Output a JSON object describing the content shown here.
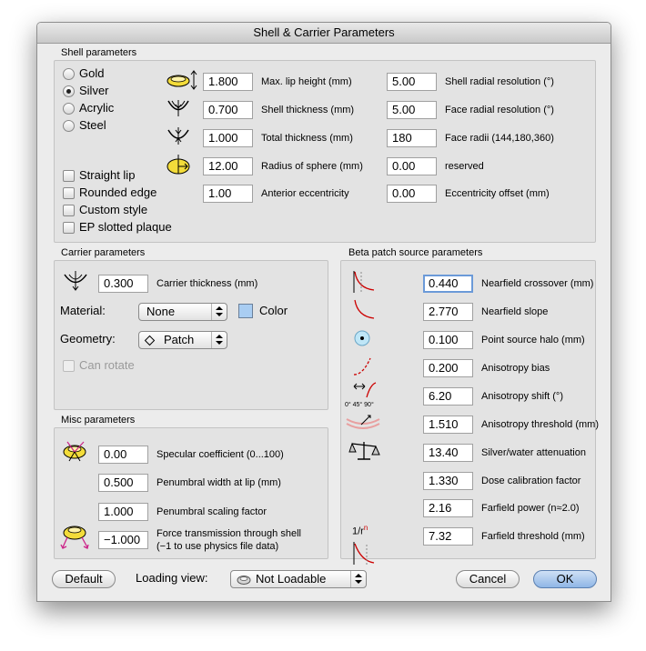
{
  "window": {
    "title": "Shell & Carrier Parameters"
  },
  "shell": {
    "title": "Shell parameters",
    "materials": [
      {
        "label": "Gold",
        "selected": false
      },
      {
        "label": "Silver",
        "selected": true
      },
      {
        "label": "Acrylic",
        "selected": false
      },
      {
        "label": "Steel",
        "selected": false
      }
    ],
    "options": [
      {
        "label": "Straight lip",
        "checked": false
      },
      {
        "label": "Rounded edge",
        "checked": false
      },
      {
        "label": "Custom style",
        "checked": false
      },
      {
        "label": "EP slotted plaque",
        "checked": false
      }
    ],
    "left_fields": [
      {
        "value": "1.800",
        "label": "Max. lip height (mm)",
        "icon": "lip-height-icon"
      },
      {
        "value": "0.700",
        "label": "Shell thickness (mm)",
        "icon": "shell-thickness-icon"
      },
      {
        "value": "1.000",
        "label": "Total thickness (mm)",
        "icon": "total-thickness-icon"
      },
      {
        "value": "12.00",
        "label": "Radius of sphere (mm)",
        "icon": "sphere-radius-icon"
      },
      {
        "value": "1.00",
        "label": "Anterior eccentricity",
        "icon": ""
      }
    ],
    "right_fields": [
      {
        "value": "5.00",
        "label": "Shell radial resolution (°)"
      },
      {
        "value": "5.00",
        "label": "Face radial resolution (°)"
      },
      {
        "value": "180",
        "label": "Face radii (144,180,360)"
      },
      {
        "value": "0.00",
        "label": "reserved"
      },
      {
        "value": "0.00",
        "label": "Eccentricity offset (mm)"
      }
    ]
  },
  "carrier": {
    "title": "Carrier parameters",
    "thickness_value": "0.300",
    "thickness_label": "Carrier thickness (mm)",
    "material_label": "Material:",
    "material_value": "None",
    "color_label": "Color",
    "color_swatch": "#a9cdf2",
    "geometry_label": "Geometry:",
    "geometry_value": "Patch",
    "can_rotate_label": "Can rotate"
  },
  "misc": {
    "title": "Misc parameters",
    "fields": [
      {
        "value": "0.00",
        "label": "Specular coefficient (0...100)"
      },
      {
        "value": "0.500",
        "label": "Penumbral width at lip (mm)"
      },
      {
        "value": "1.000",
        "label": "Penumbral scaling factor"
      },
      {
        "value": "−1.000",
        "label": "Force transmission through shell",
        "sublabel": "(−1 to use physics file data)"
      }
    ]
  },
  "beta": {
    "title": "Beta patch source parameters",
    "power_icon_text": "1/r",
    "power_icon_sup": "n",
    "shift_icon_text": "0° 45° 90°",
    "fields": [
      {
        "value": "0.440",
        "label": "Nearfield crossover (mm)"
      },
      {
        "value": "2.770",
        "label": "Nearfield slope"
      },
      {
        "value": "0.100",
        "label": "Point source halo (mm)"
      },
      {
        "value": "0.200",
        "label": "Anisotropy bias"
      },
      {
        "value": "6.20",
        "label": "Anisotropy shift (°)"
      },
      {
        "value": "1.510",
        "label": "Anisotropy threshold (mm)"
      },
      {
        "value": "13.40",
        "label": "Silver/water attenuation"
      },
      {
        "value": "1.330",
        "label": "Dose calibration factor"
      },
      {
        "value": "2.16",
        "label": "Farfield power (n≈2.0)"
      },
      {
        "value": "7.32",
        "label": "Farfield threshold (mm)"
      }
    ]
  },
  "footer": {
    "default_label": "Default",
    "loading_view_label": "Loading view:",
    "loading_view_value": "Not Loadable",
    "cancel_label": "Cancel",
    "ok_label": "OK"
  }
}
